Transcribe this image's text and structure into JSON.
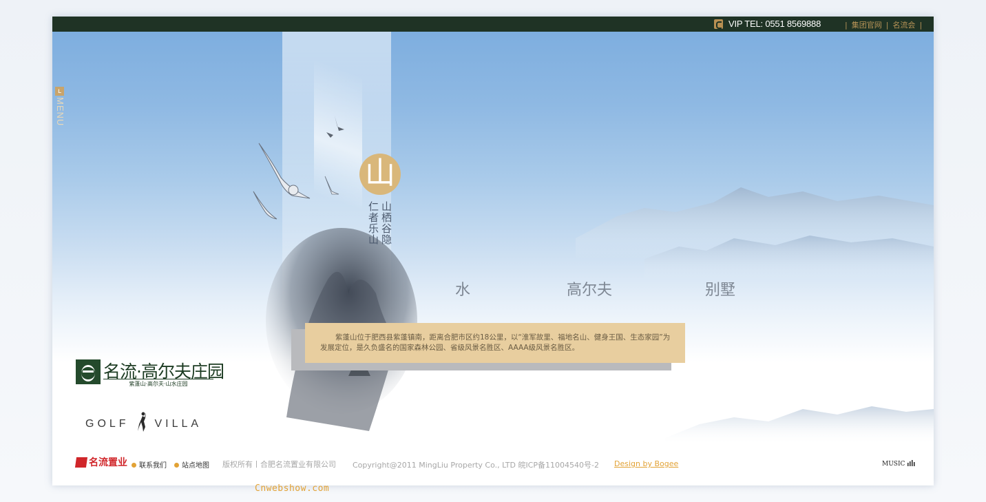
{
  "topbar": {
    "tel_label": "VIP TEL: 0551 8569888",
    "links": [
      "集团官网",
      "名流会"
    ],
    "separator": "|"
  },
  "menu": {
    "label": "MENU",
    "glyph": "ʟ"
  },
  "hero": {
    "seal_char": "山",
    "poem_right": "山栖谷隐",
    "poem_left": "仁者乐山"
  },
  "nav": {
    "items": [
      "水",
      "高尔夫",
      "别墅"
    ]
  },
  "description": "紫蓬山位于肥西县紫蓬镇南，距离合肥市区约18公里，以“淮军故里、福地名山、健身王国、生态家园”为发展定位，是久负盛名的国家森林公园、省级风景名胜区、AAAA级风景名胜区。",
  "brand": {
    "title": "名流·高尔夫庄园",
    "subtitle": "紫蓬山·高尔夫·山水庄园",
    "golf_left": "GOLF",
    "golf_right": "VILLA"
  },
  "footer": {
    "logo_text": "名流置业",
    "contact": "联系我们",
    "sitemap": "站点地图",
    "copyright_cn": "版权所有丨合肥名流置业有限公司",
    "copyright_en": "Copyright@2011 MingLiu Property Co., LTD  皖ICP备11004540号-2",
    "design": "Design by Bogee",
    "music": "MUSIC"
  },
  "watermark": "Cnwebshow.com",
  "colors": {
    "topbar": "#1f3325",
    "accent": "#e2a235",
    "desc_box": "#e8ce9f",
    "brand_green": "#1c3b22"
  },
  "icons": [
    "phone-icon",
    "menu-icon",
    "bird-icon",
    "mountain-icon",
    "golfer-icon",
    "music-bars-icon"
  ]
}
